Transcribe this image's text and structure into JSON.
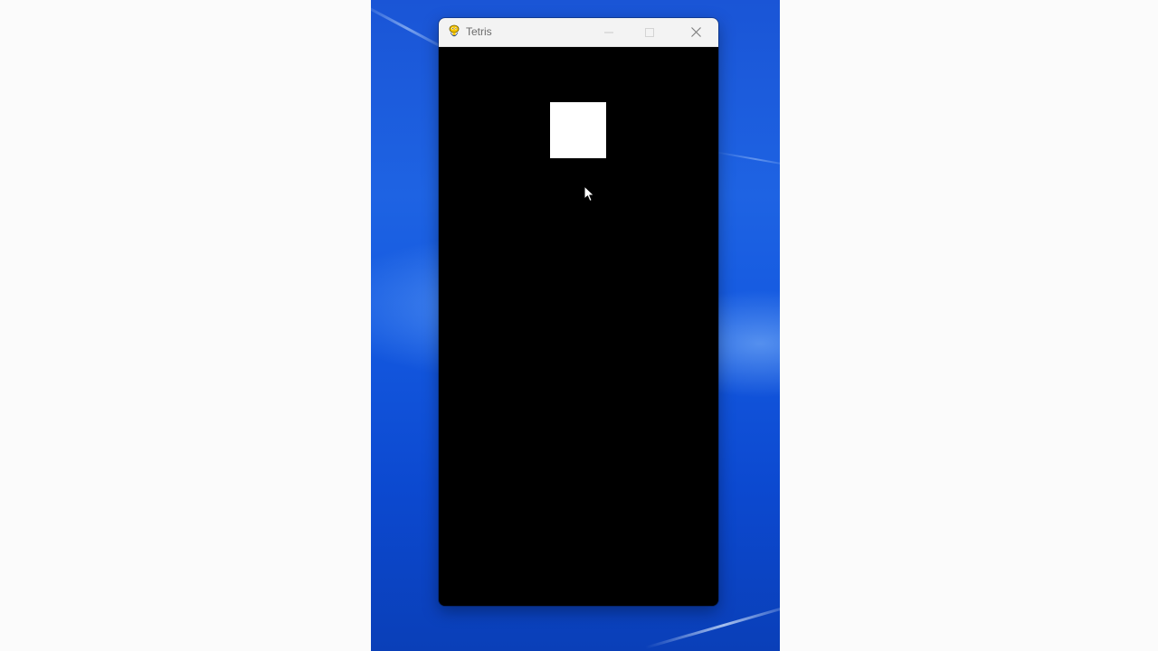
{
  "window": {
    "title": "Tetris",
    "icon": "pygame-snake-icon",
    "controls": {
      "minimize": "minimize-icon",
      "maximize": "maximize-icon",
      "close": "close-icon"
    }
  },
  "game": {
    "background_color": "#000000",
    "piece_color": "#ffffff"
  },
  "desktop": {
    "wallpaper_color": "#1459e0",
    "page_background": "#fbfbfb"
  }
}
